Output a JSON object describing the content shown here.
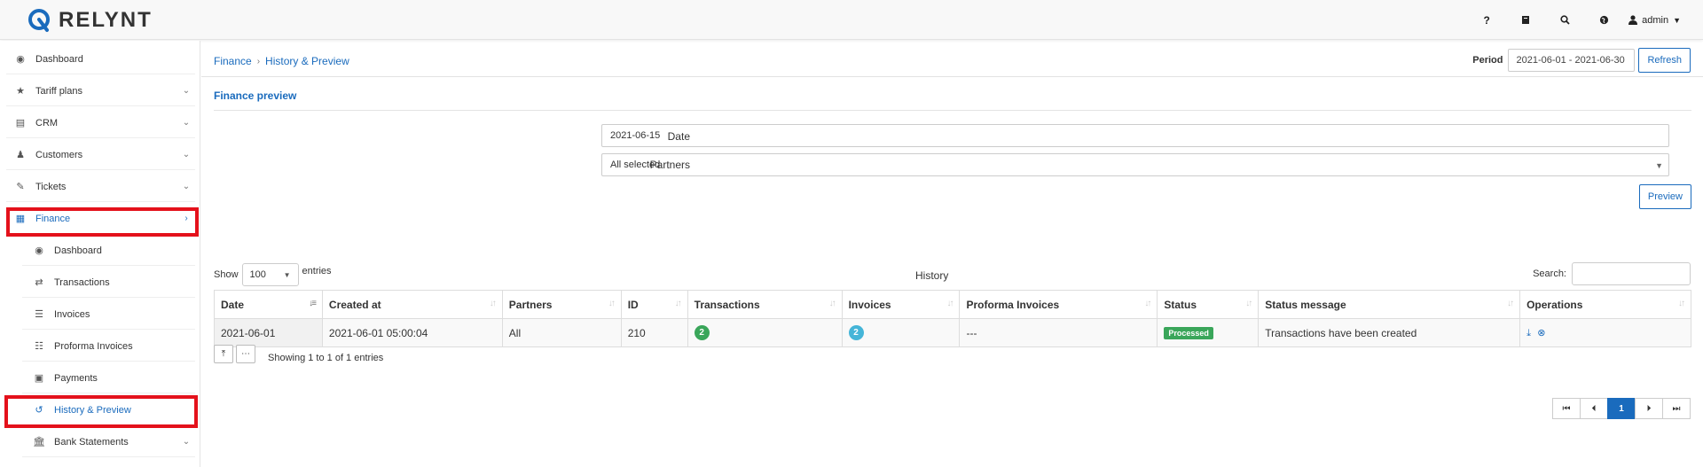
{
  "app": {
    "brand": "RELYNT",
    "accent": "#1a6bbd",
    "highlight_color": "#e4111b"
  },
  "topbar": {
    "icons": [
      "help-icon",
      "book-icon",
      "search-icon",
      "globe-icon"
    ],
    "help_glyph": "?",
    "user": "admin"
  },
  "sidebar": {
    "items": [
      {
        "label": "Dashboard",
        "icon": "dashboard-icon",
        "glyph": "◉",
        "chevron": ""
      },
      {
        "label": "Tariff plans",
        "icon": "star-icon",
        "glyph": "★",
        "chevron": "⌄"
      },
      {
        "label": "CRM",
        "icon": "crm-icon",
        "glyph": "▤",
        "chevron": "⌄"
      },
      {
        "label": "Customers",
        "icon": "user-icon",
        "glyph": "♟",
        "chevron": "⌄"
      },
      {
        "label": "Tickets",
        "icon": "ticket-icon",
        "glyph": "✎",
        "chevron": "⌄"
      },
      {
        "label": "Finance",
        "icon": "calculator-icon",
        "glyph": "▦",
        "chevron": "›"
      }
    ],
    "finance_sub": [
      {
        "label": "Dashboard",
        "icon": "dashboard-icon",
        "glyph": "◉"
      },
      {
        "label": "Transactions",
        "icon": "exchange-icon",
        "glyph": "⇄"
      },
      {
        "label": "Invoices",
        "icon": "list-icon",
        "glyph": "☰"
      },
      {
        "label": "Proforma Invoices",
        "icon": "list-alt-icon",
        "glyph": "☷"
      },
      {
        "label": "Payments",
        "icon": "archive-icon",
        "glyph": "▣"
      },
      {
        "label": "History & Preview",
        "icon": "history-icon",
        "glyph": "↺"
      },
      {
        "label": "Bank Statements",
        "icon": "bank-icon",
        "glyph": "🏛",
        "chevron": "⌄"
      }
    ]
  },
  "breadcrumb": {
    "parent": "Finance",
    "sep": "›",
    "current": "History & Preview"
  },
  "period": {
    "label": "Period",
    "value": "2021-06-01 - 2021-06-30",
    "refresh": "Refresh"
  },
  "preview": {
    "title": "Finance preview",
    "date_label": "Date",
    "date_value": "2021-06-15",
    "partners_label": "Partners",
    "partners_value": "All selected",
    "button": "Preview"
  },
  "history": {
    "show_label": "Show",
    "entries_label": "entries",
    "page_size": "100",
    "title": "History",
    "search_label": "Search:",
    "columns": [
      "Date",
      "Created at",
      "Partners",
      "ID",
      "Transactions",
      "Invoices",
      "Proforma Invoices",
      "Status",
      "Status message",
      "Operations"
    ],
    "rows": [
      {
        "date": "2021-06-01",
        "created_at": "2021-06-01 05:00:04",
        "partners": "All",
        "id": "210",
        "transactions": "2",
        "invoices": "2",
        "proforma": "---",
        "status": "Processed",
        "status_message": "Transactions have been created"
      }
    ],
    "showing": "Showing 1 to 1 of 1 entries",
    "pages": [
      "⏮",
      "⏴",
      "1",
      "⏵",
      "⏭"
    ],
    "transactions_badge_color": "#3aa65a",
    "invoices_badge_color": "#45b5d8"
  }
}
